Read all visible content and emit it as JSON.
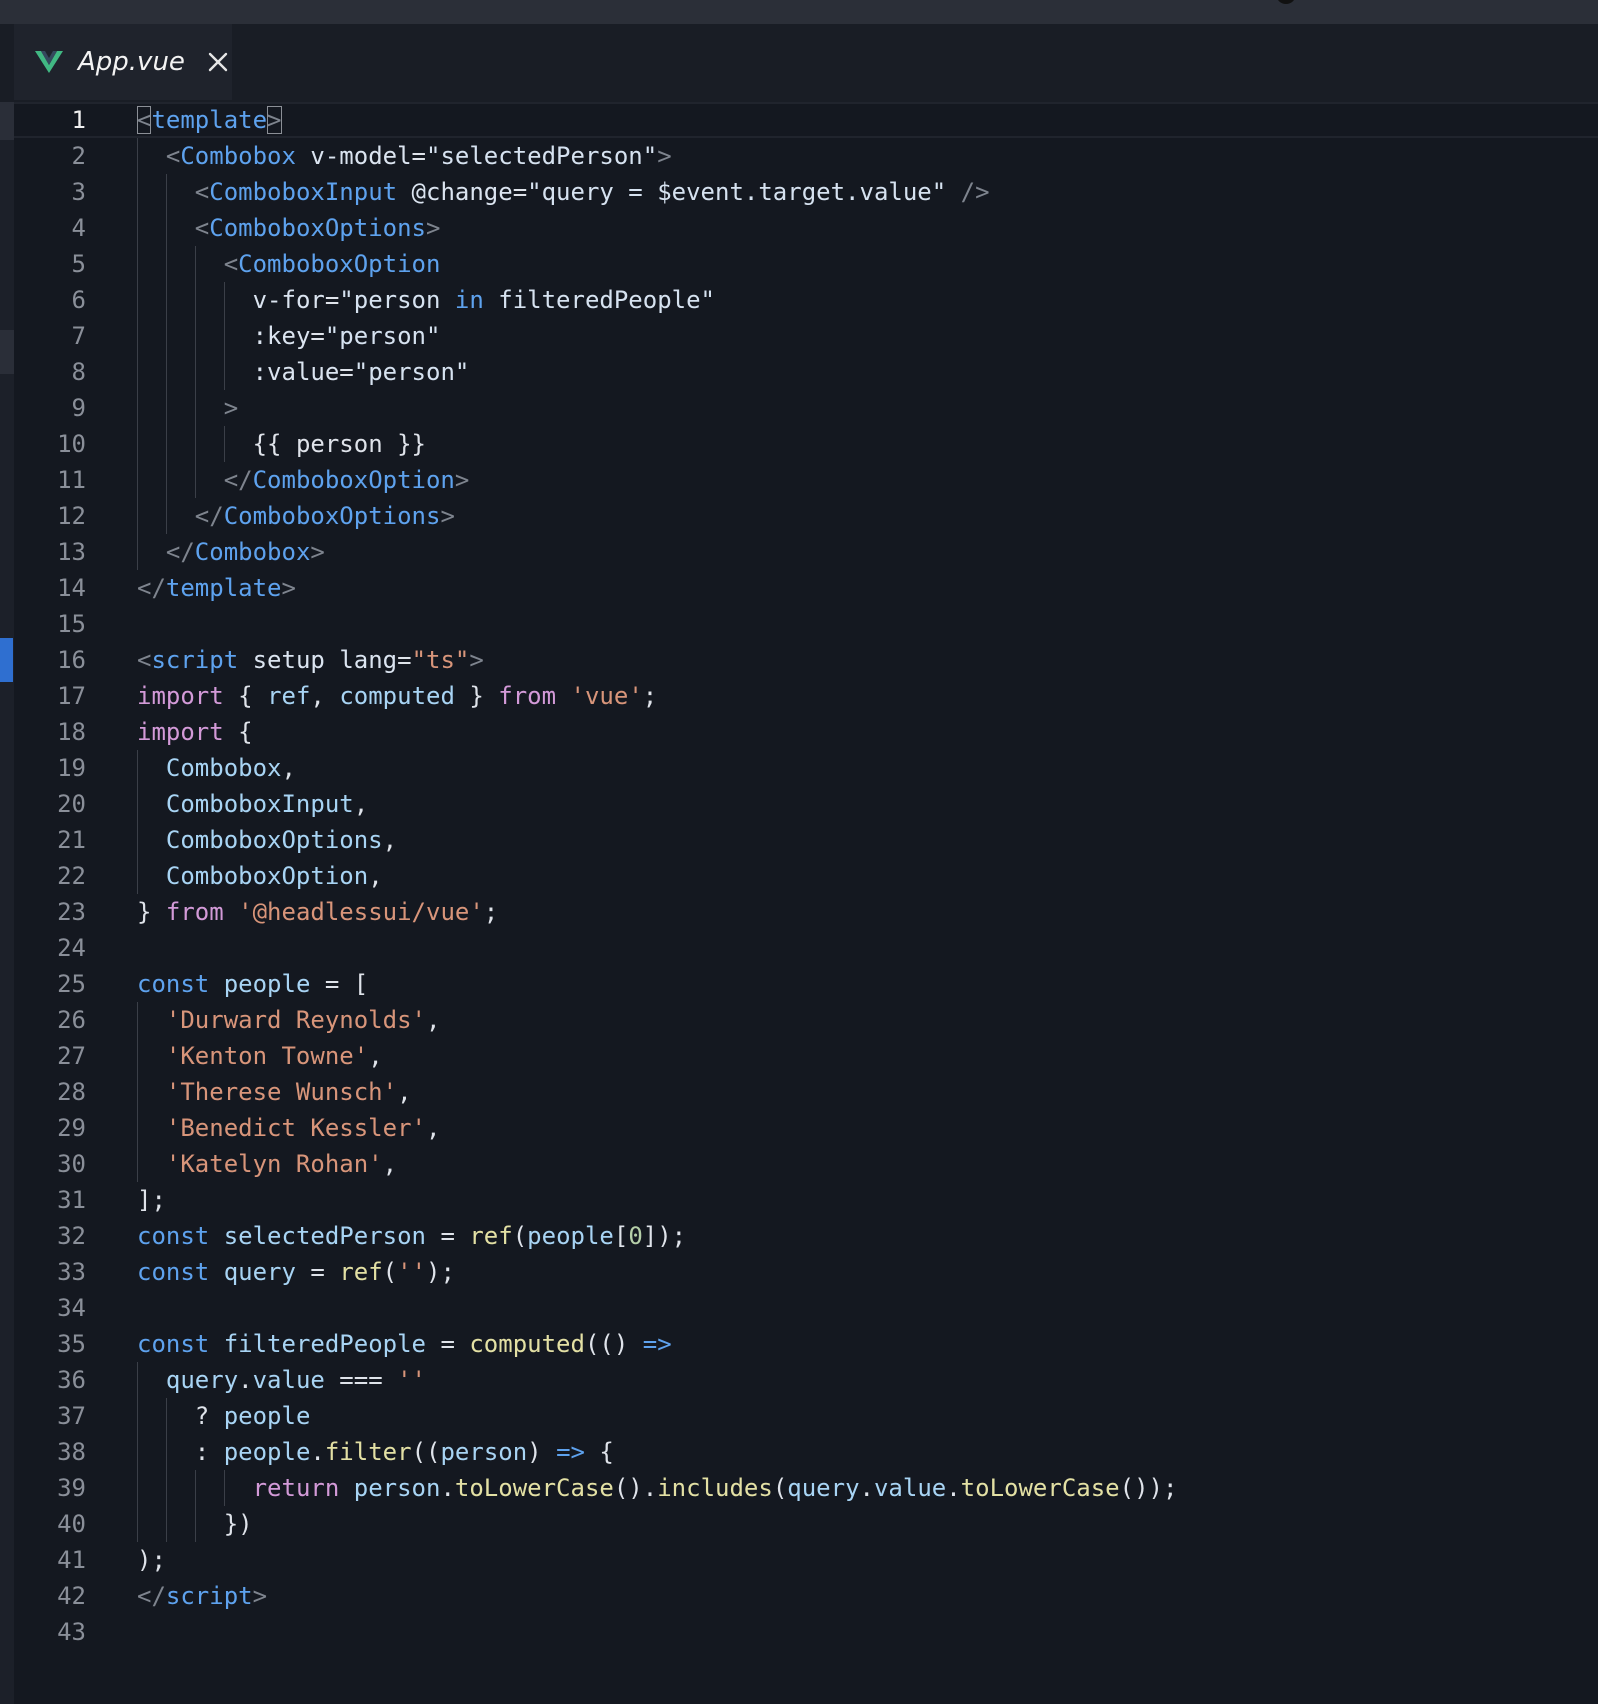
{
  "tab": {
    "icon": "vue-logo-icon",
    "filename": "App.vue",
    "close_icon": "close-icon"
  },
  "editor": {
    "active_line": 1,
    "modified_line": 16
  },
  "lines": [
    {
      "n": "1",
      "indent": 0,
      "tokens": [
        {
          "c": "tg",
          "t": "<",
          "box": true
        },
        {
          "c": "tn",
          "t": "template"
        },
        {
          "c": "tg",
          "t": ">",
          "box": true
        }
      ]
    },
    {
      "n": "2",
      "indent": 1,
      "tokens": [
        {
          "c": "tg",
          "t": "<"
        },
        {
          "c": "tn",
          "t": "Combobox"
        },
        {
          "c": "pl",
          "t": " "
        },
        {
          "c": "at",
          "t": "v-model"
        },
        {
          "c": "pl",
          "t": "="
        },
        {
          "c": "st",
          "t": "\"selectedPerson\""
        },
        {
          "c": "tg",
          "t": ">"
        }
      ]
    },
    {
      "n": "3",
      "indent": 2,
      "tokens": [
        {
          "c": "tg",
          "t": "<"
        },
        {
          "c": "tn",
          "t": "ComboboxInput"
        },
        {
          "c": "pl",
          "t": " "
        },
        {
          "c": "at",
          "t": "@change"
        },
        {
          "c": "pl",
          "t": "="
        },
        {
          "c": "st",
          "t": "\"query = $event.target.value\""
        },
        {
          "c": "pl",
          "t": " "
        },
        {
          "c": "tg",
          "t": "/>"
        }
      ]
    },
    {
      "n": "4",
      "indent": 2,
      "tokens": [
        {
          "c": "tg",
          "t": "<"
        },
        {
          "c": "tn",
          "t": "ComboboxOptions"
        },
        {
          "c": "tg",
          "t": ">"
        }
      ]
    },
    {
      "n": "5",
      "indent": 3,
      "tokens": [
        {
          "c": "tg",
          "t": "<"
        },
        {
          "c": "tn",
          "t": "ComboboxOption"
        }
      ]
    },
    {
      "n": "6",
      "indent": 4,
      "tokens": [
        {
          "c": "at",
          "t": "v-for"
        },
        {
          "c": "pl",
          "t": "="
        },
        {
          "c": "st",
          "t": "\"person "
        },
        {
          "c": "dec",
          "t": "in"
        },
        {
          "c": "st",
          "t": " filteredPeople\""
        }
      ]
    },
    {
      "n": "7",
      "indent": 4,
      "tokens": [
        {
          "c": "at",
          "t": ":key"
        },
        {
          "c": "pl",
          "t": "="
        },
        {
          "c": "st",
          "t": "\"person\""
        }
      ]
    },
    {
      "n": "8",
      "indent": 4,
      "tokens": [
        {
          "c": "at",
          "t": ":value"
        },
        {
          "c": "pl",
          "t": "="
        },
        {
          "c": "st",
          "t": "\"person\""
        }
      ]
    },
    {
      "n": "9",
      "indent": 3,
      "tokens": [
        {
          "c": "tg",
          "t": ">"
        }
      ]
    },
    {
      "n": "10",
      "indent": 4,
      "tokens": [
        {
          "c": "pl",
          "t": "{{ person }}"
        }
      ]
    },
    {
      "n": "11",
      "indent": 3,
      "tokens": [
        {
          "c": "tg",
          "t": "</"
        },
        {
          "c": "tn",
          "t": "ComboboxOption"
        },
        {
          "c": "tg",
          "t": ">"
        }
      ]
    },
    {
      "n": "12",
      "indent": 2,
      "tokens": [
        {
          "c": "tg",
          "t": "</"
        },
        {
          "c": "tn",
          "t": "ComboboxOptions"
        },
        {
          "c": "tg",
          "t": ">"
        }
      ]
    },
    {
      "n": "13",
      "indent": 1,
      "tokens": [
        {
          "c": "tg",
          "t": "</"
        },
        {
          "c": "tn",
          "t": "Combobox"
        },
        {
          "c": "tg",
          "t": ">"
        }
      ]
    },
    {
      "n": "14",
      "indent": 0,
      "tokens": [
        {
          "c": "tg",
          "t": "</"
        },
        {
          "c": "tn",
          "t": "template"
        },
        {
          "c": "tg",
          "t": ">"
        }
      ]
    },
    {
      "n": "15",
      "indent": 0,
      "tokens": []
    },
    {
      "n": "16",
      "indent": 0,
      "tokens": [
        {
          "c": "tg",
          "t": "<"
        },
        {
          "c": "tn",
          "t": "script"
        },
        {
          "c": "pl",
          "t": " "
        },
        {
          "c": "at",
          "t": "setup"
        },
        {
          "c": "pl",
          "t": " "
        },
        {
          "c": "at",
          "t": "lang"
        },
        {
          "c": "pl",
          "t": "="
        },
        {
          "c": "str",
          "t": "\"ts\""
        },
        {
          "c": "tg",
          "t": ">"
        }
      ]
    },
    {
      "n": "17",
      "indent": 0,
      "tokens": [
        {
          "c": "kw",
          "t": "import"
        },
        {
          "c": "pl",
          "t": " { "
        },
        {
          "c": "var",
          "t": "ref"
        },
        {
          "c": "pl",
          "t": ", "
        },
        {
          "c": "var",
          "t": "computed"
        },
        {
          "c": "pl",
          "t": " } "
        },
        {
          "c": "kw",
          "t": "from"
        },
        {
          "c": "pl",
          "t": " "
        },
        {
          "c": "str",
          "t": "'vue'"
        },
        {
          "c": "pl",
          "t": ";"
        }
      ]
    },
    {
      "n": "18",
      "indent": 0,
      "tokens": [
        {
          "c": "kw",
          "t": "import"
        },
        {
          "c": "pl",
          "t": " {"
        }
      ]
    },
    {
      "n": "19",
      "indent": 1,
      "tokens": [
        {
          "c": "var",
          "t": "Combobox"
        },
        {
          "c": "pl",
          "t": ","
        }
      ]
    },
    {
      "n": "20",
      "indent": 1,
      "tokens": [
        {
          "c": "var",
          "t": "ComboboxInput"
        },
        {
          "c": "pl",
          "t": ","
        }
      ]
    },
    {
      "n": "21",
      "indent": 1,
      "tokens": [
        {
          "c": "var",
          "t": "ComboboxOptions"
        },
        {
          "c": "pl",
          "t": ","
        }
      ]
    },
    {
      "n": "22",
      "indent": 1,
      "tokens": [
        {
          "c": "var",
          "t": "ComboboxOption"
        },
        {
          "c": "pl",
          "t": ","
        }
      ]
    },
    {
      "n": "23",
      "indent": 0,
      "tokens": [
        {
          "c": "pl",
          "t": "} "
        },
        {
          "c": "kw",
          "t": "from"
        },
        {
          "c": "pl",
          "t": " "
        },
        {
          "c": "str",
          "t": "'@headlessui/vue'"
        },
        {
          "c": "pl",
          "t": ";"
        }
      ]
    },
    {
      "n": "24",
      "indent": 0,
      "tokens": []
    },
    {
      "n": "25",
      "indent": 0,
      "tokens": [
        {
          "c": "dec",
          "t": "const"
        },
        {
          "c": "pl",
          "t": " "
        },
        {
          "c": "var",
          "t": "people"
        },
        {
          "c": "pl",
          "t": " = ["
        }
      ]
    },
    {
      "n": "26",
      "indent": 1,
      "tokens": [
        {
          "c": "str",
          "t": "'Durward Reynolds'"
        },
        {
          "c": "pl",
          "t": ","
        }
      ]
    },
    {
      "n": "27",
      "indent": 1,
      "tokens": [
        {
          "c": "str",
          "t": "'Kenton Towne'"
        },
        {
          "c": "pl",
          "t": ","
        }
      ]
    },
    {
      "n": "28",
      "indent": 1,
      "tokens": [
        {
          "c": "str",
          "t": "'Therese Wunsch'"
        },
        {
          "c": "pl",
          "t": ","
        }
      ]
    },
    {
      "n": "29",
      "indent": 1,
      "tokens": [
        {
          "c": "str",
          "t": "'Benedict Kessler'"
        },
        {
          "c": "pl",
          "t": ","
        }
      ]
    },
    {
      "n": "30",
      "indent": 1,
      "tokens": [
        {
          "c": "str",
          "t": "'Katelyn Rohan'"
        },
        {
          "c": "pl",
          "t": ","
        }
      ]
    },
    {
      "n": "31",
      "indent": 0,
      "tokens": [
        {
          "c": "pl",
          "t": "];"
        }
      ]
    },
    {
      "n": "32",
      "indent": 0,
      "tokens": [
        {
          "c": "dec",
          "t": "const"
        },
        {
          "c": "pl",
          "t": " "
        },
        {
          "c": "var",
          "t": "selectedPerson"
        },
        {
          "c": "pl",
          "t": " = "
        },
        {
          "c": "fn",
          "t": "ref"
        },
        {
          "c": "pl",
          "t": "("
        },
        {
          "c": "var",
          "t": "people"
        },
        {
          "c": "pl",
          "t": "["
        },
        {
          "c": "num",
          "t": "0"
        },
        {
          "c": "pl",
          "t": "]);"
        }
      ]
    },
    {
      "n": "33",
      "indent": 0,
      "tokens": [
        {
          "c": "dec",
          "t": "const"
        },
        {
          "c": "pl",
          "t": " "
        },
        {
          "c": "var",
          "t": "query"
        },
        {
          "c": "pl",
          "t": " = "
        },
        {
          "c": "fn",
          "t": "ref"
        },
        {
          "c": "pl",
          "t": "("
        },
        {
          "c": "str",
          "t": "''"
        },
        {
          "c": "pl",
          "t": ");"
        }
      ]
    },
    {
      "n": "34",
      "indent": 0,
      "tokens": []
    },
    {
      "n": "35",
      "indent": 0,
      "tokens": [
        {
          "c": "dec",
          "t": "const"
        },
        {
          "c": "pl",
          "t": " "
        },
        {
          "c": "var",
          "t": "filteredPeople"
        },
        {
          "c": "pl",
          "t": " = "
        },
        {
          "c": "fn",
          "t": "computed"
        },
        {
          "c": "pl",
          "t": "(() "
        },
        {
          "c": "dec",
          "t": "=>"
        }
      ]
    },
    {
      "n": "36",
      "indent": 1,
      "tokens": [
        {
          "c": "var",
          "t": "query"
        },
        {
          "c": "pl",
          "t": "."
        },
        {
          "c": "var",
          "t": "value"
        },
        {
          "c": "pl",
          "t": " === "
        },
        {
          "c": "str",
          "t": "''"
        }
      ]
    },
    {
      "n": "37",
      "indent": 2,
      "tokens": [
        {
          "c": "pl",
          "t": "? "
        },
        {
          "c": "var",
          "t": "people"
        }
      ]
    },
    {
      "n": "38",
      "indent": 2,
      "tokens": [
        {
          "c": "pl",
          "t": ": "
        },
        {
          "c": "var",
          "t": "people"
        },
        {
          "c": "pl",
          "t": "."
        },
        {
          "c": "fn",
          "t": "filter"
        },
        {
          "c": "pl",
          "t": "(("
        },
        {
          "c": "var",
          "t": "person"
        },
        {
          "c": "pl",
          "t": ") "
        },
        {
          "c": "dec",
          "t": "=>"
        },
        {
          "c": "pl",
          "t": " {"
        }
      ]
    },
    {
      "n": "39",
      "indent": 4,
      "tokens": [
        {
          "c": "kw",
          "t": "return"
        },
        {
          "c": "pl",
          "t": " "
        },
        {
          "c": "var",
          "t": "person"
        },
        {
          "c": "pl",
          "t": "."
        },
        {
          "c": "fn",
          "t": "toLowerCase"
        },
        {
          "c": "pl",
          "t": "()."
        },
        {
          "c": "fn",
          "t": "includes"
        },
        {
          "c": "pl",
          "t": "("
        },
        {
          "c": "var",
          "t": "query"
        },
        {
          "c": "pl",
          "t": "."
        },
        {
          "c": "var",
          "t": "value"
        },
        {
          "c": "pl",
          "t": "."
        },
        {
          "c": "fn",
          "t": "toLowerCase"
        },
        {
          "c": "pl",
          "t": "());"
        }
      ]
    },
    {
      "n": "40",
      "indent": 3,
      "tokens": [
        {
          "c": "pl",
          "t": "})"
        }
      ]
    },
    {
      "n": "41",
      "indent": 0,
      "tokens": [
        {
          "c": "pl",
          "t": ");"
        }
      ]
    },
    {
      "n": "42",
      "indent": 0,
      "tokens": [
        {
          "c": "tg",
          "t": "</"
        },
        {
          "c": "tn",
          "t": "script"
        },
        {
          "c": "tg",
          "t": ">"
        }
      ]
    },
    {
      "n": "43",
      "indent": 0,
      "tokens": []
    }
  ]
}
